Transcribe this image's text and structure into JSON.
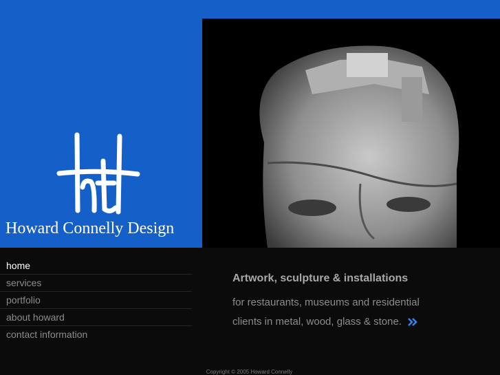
{
  "brand": {
    "name": "Howard Connelly Design",
    "logo_icon": "hc-monogram-icon"
  },
  "photo": {
    "subject": "stone-sculpture-head"
  },
  "nav": {
    "items": [
      {
        "label": "home",
        "active": true
      },
      {
        "label": "services",
        "active": false
      },
      {
        "label": "portfolio",
        "active": false
      },
      {
        "label": "about howard",
        "active": false
      },
      {
        "label": "contact information",
        "active": false
      }
    ]
  },
  "tagline": {
    "heading": "Artwork, sculpture & installations",
    "line1": "for restaurants, museums and residential",
    "line2": "clients in metal, wood, glass & stone.",
    "more_icon": "double-chevron-right-icon"
  },
  "footer": {
    "copyright": "Copyright © 2005 Howard Connelly"
  },
  "colors": {
    "hero_blue": "#1560c8",
    "background": "#0b0b0b",
    "accent_arrow": "#3f7fe0"
  }
}
